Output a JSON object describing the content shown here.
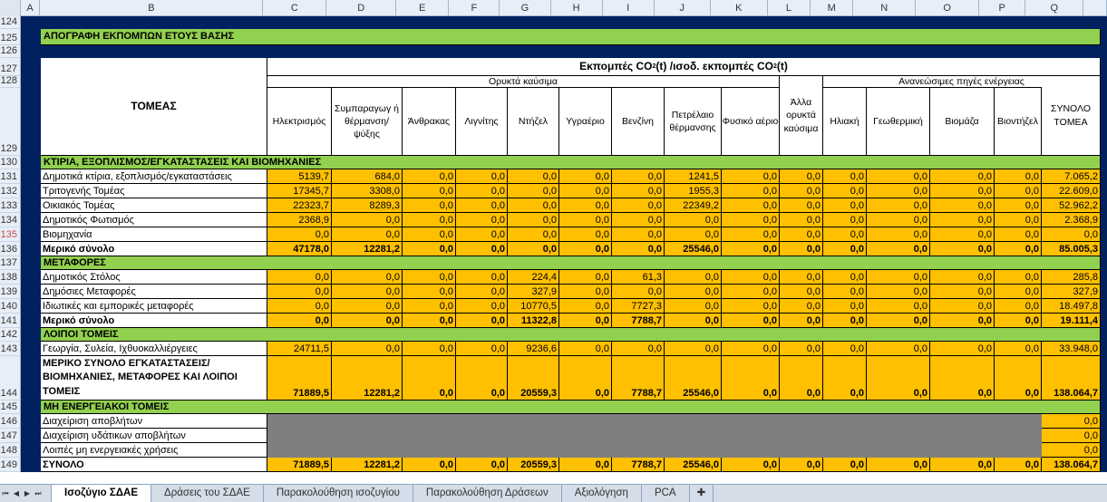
{
  "columns": [
    "A",
    "B",
    "C",
    "D",
    "E",
    "F",
    "G",
    "H",
    "I",
    "J",
    "K",
    "L",
    "M",
    "N",
    "O",
    "P",
    "Q"
  ],
  "title": "ΑΠΟΓΡΑΦΗ ΕΚΠΟΜΠΩΝ ΕΤΟΥΣ ΒΑΣΗΣ",
  "header": {
    "main_pre": "Εκπομπές CO",
    "main_mid": "(t) /ισοδ. εκπομπές CO",
    "main_post": "(t)",
    "sub2": "2",
    "tomeas": "ΤΟΜΕΑΣ",
    "fossil": "Ορυκτά καύσιμα",
    "renew": "Ανανεώσιμες πηγές ενέργειας",
    "cols": [
      "Ηλεκτρισμός",
      "Συμπαραγωγ ή θέρμανση/ ψύξης",
      "Άνθρακας",
      "Λιγνίτης",
      "Ντήζελ",
      "Υγραέριο",
      "Βενζίνη",
      "Πετρέλαιο θέρμανσης",
      "Φυσικό αέριο",
      "Άλλα ορυκτά καύσιμα",
      "Ηλιακή",
      "Γεωθερμική",
      "Βιομάζα",
      "Βιοντήζελ",
      "ΣΥΝΟΛΟ ΤΟΜΕΑ"
    ]
  },
  "sec1": "ΚΤΙΡΙΑ, ΕΞΟΠΛΙΣΜΟΣ/ΕΓΚΑΤΑΣΤΑΣΕΙΣ ΚΑΙ ΒΙΟΜΗΧΑΝΙΕΣ",
  "sec2": "ΜΕΤΑΦΟΡΕΣ",
  "sec3": "ΛΟΙΠΟΙ ΤΟΜΕΙΣ",
  "sec4": "ΜΗ ΕΝΕΡΓΕΙΑΚΟΙ ΤΟΜΕΙΣ",
  "r131": [
    "Δημοτικά κτίρια, εξοπλισμός/εγκαταστάσεις",
    "5139,7",
    "684,0",
    "0,0",
    "0,0",
    "0,0",
    "0,0",
    "0,0",
    "1241,5",
    "0,0",
    "0,0",
    "0,0",
    "0,0",
    "0,0",
    "0,0",
    "7.065,2"
  ],
  "r132": [
    "Τριτογενής Τομέας",
    "17345,7",
    "3308,0",
    "0,0",
    "0,0",
    "0,0",
    "0,0",
    "0,0",
    "1955,3",
    "0,0",
    "0,0",
    "0,0",
    "0,0",
    "0,0",
    "0,0",
    "22.609,0"
  ],
  "r133": [
    "Οικιακός Τομέας",
    "22323,7",
    "8289,3",
    "0,0",
    "0,0",
    "0,0",
    "0,0",
    "0,0",
    "22349,2",
    "0,0",
    "0,0",
    "0,0",
    "0,0",
    "0,0",
    "0,0",
    "52.962,2"
  ],
  "r134": [
    "Δημοτικός Φωτισμός",
    "2368,9",
    "0,0",
    "0,0",
    "0,0",
    "0,0",
    "0,0",
    "0,0",
    "0,0",
    "0,0",
    "0,0",
    "0,0",
    "0,0",
    "0,0",
    "0,0",
    "2.368,9"
  ],
  "r135": [
    "Βιομηχανία",
    "0,0",
    "0,0",
    "0,0",
    "0,0",
    "0,0",
    "0,0",
    "0,0",
    "0,0",
    "0,0",
    "0,0",
    "0,0",
    "0,0",
    "0,0",
    "0,0",
    "0,0"
  ],
  "r136": [
    "Μερικό σύνολο",
    "47178,0",
    "12281,2",
    "0,0",
    "0,0",
    "0,0",
    "0,0",
    "0,0",
    "25546,0",
    "0,0",
    "0,0",
    "0,0",
    "0,0",
    "0,0",
    "0,0",
    "85.005,3"
  ],
  "r138": [
    "Δημοτικός Στόλος",
    "0,0",
    "0,0",
    "0,0",
    "0,0",
    "224,4",
    "0,0",
    "61,3",
    "0,0",
    "0,0",
    "0,0",
    "0,0",
    "0,0",
    "0,0",
    "0,0",
    "285,8"
  ],
  "r139": [
    "Δημόσιες Μεταφορές",
    "0,0",
    "0,0",
    "0,0",
    "0,0",
    "327,9",
    "0,0",
    "0,0",
    "0,0",
    "0,0",
    "0,0",
    "0,0",
    "0,0",
    "0,0",
    "0,0",
    "327,9"
  ],
  "r140": [
    "Ιδιωτικές και εμπορικές μεταφορές",
    "0,0",
    "0,0",
    "0,0",
    "0,0",
    "10770,5",
    "0,0",
    "7727,3",
    "0,0",
    "0,0",
    "0,0",
    "0,0",
    "0,0",
    "0,0",
    "0,0",
    "18.497,8"
  ],
  "r141": [
    "Μερικό σύνολο",
    "0,0",
    "0,0",
    "0,0",
    "0,0",
    "11322,8",
    "0,0",
    "7788,7",
    "0,0",
    "0,0",
    "0,0",
    "0,0",
    "0,0",
    "0,0",
    "0,0",
    "19.111,4"
  ],
  "r143": [
    "Γεωργία, Συλεία, Ιχθυοκαλλιέργειες",
    "24711,5",
    "0,0",
    "0,0",
    "0,0",
    "9236,6",
    "0,0",
    "0,0",
    "0,0",
    "0,0",
    "0,0",
    "0,0",
    "0,0",
    "0,0",
    "0,0",
    "33.948,0"
  ],
  "r144": [
    "ΜΕΡΙΚΟ ΣΥΝΟΛΟ ΕΓΚΑΤΑΣΤΑΣΕΙΣ/ΒΙΟΜΗΧΑΝΙΕΣ, ΜΕΤΑΦΟΡΕΣ ΚΑΙ ΛΟΙΠΟΙ ΤΟΜΕΙΣ",
    "71889,5",
    "12281,2",
    "0,0",
    "0,0",
    "20559,3",
    "0,0",
    "7788,7",
    "25546,0",
    "0,0",
    "0,0",
    "0,0",
    "0,0",
    "0,0",
    "0,0",
    "138.064,7"
  ],
  "r146": [
    "Διαχείριση αποβλήτων",
    "0,0"
  ],
  "r147": [
    "Διαχείριση υδάτικων αποβλήτων",
    "0,0"
  ],
  "r148": [
    "Λοιπές μη ενεργειακές χρήσεις",
    "0,0"
  ],
  "r149": [
    "ΣΥΝΟΛΟ",
    "71889,5",
    "12281,2",
    "0,0",
    "0,0",
    "20559,3",
    "0,0",
    "7788,7",
    "25546,0",
    "0,0",
    "0,0",
    "0,0",
    "0,0",
    "0,0",
    "0,0",
    "138.064,7"
  ],
  "tabs": [
    "Ισοζύγιο ΣΔΑΕ",
    "Δράσεις του ΣΔΑΕ",
    "Παρακολούθηση ισοζυγίου",
    "Παρακολούθηση Δράσεων",
    "Αξιολόγηση",
    "PCA"
  ],
  "colors": {
    "navy": "#002060",
    "green": "#92d050",
    "orange": "#ffc000",
    "gray": "#7f7f7f"
  }
}
